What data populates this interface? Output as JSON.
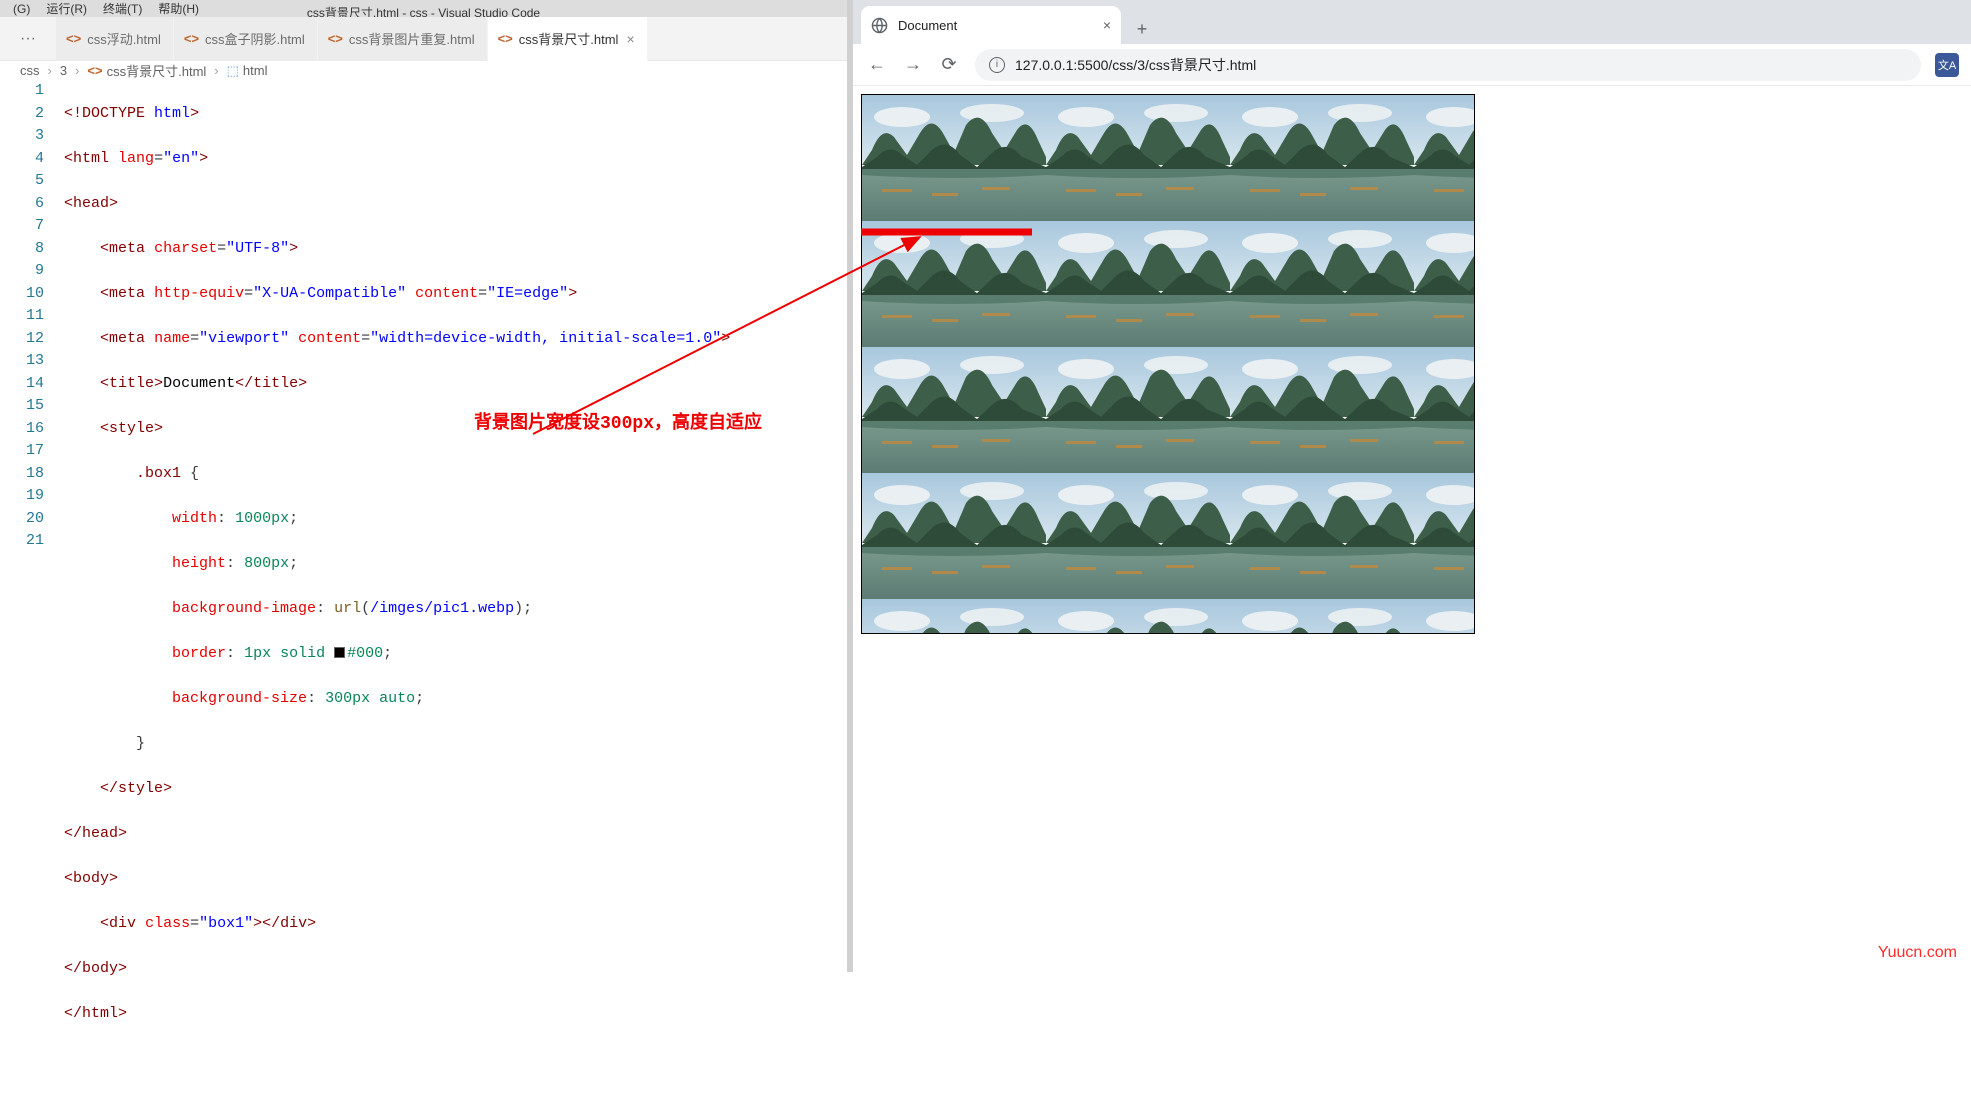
{
  "vscode": {
    "menubar": [
      "(G)",
      "运行(R)",
      "终端(T)",
      "帮助(H)"
    ],
    "title": "css背景尺寸.html - css - Visual Studio Code",
    "tabs": [
      {
        "label": "css浮动.html",
        "active": false
      },
      {
        "label": "css盒子阴影.html",
        "active": false
      },
      {
        "label": "css背景图片重复.html",
        "active": false
      },
      {
        "label": "css背景尺寸.html",
        "active": true
      }
    ],
    "breadcrumbs": {
      "parts": [
        "css",
        "3"
      ],
      "file": "css背景尺寸.html",
      "symbol": "html"
    },
    "line_count": 21,
    "code": {
      "l1_doctype": "!DOCTYPE",
      "l1_html": "html",
      "l2_tag": "html",
      "l2_attr": "lang",
      "l2_val": "\"en\"",
      "l3_tag": "head",
      "l4_tag": "meta",
      "l4_attr": "charset",
      "l4_val": "\"UTF-8\"",
      "l5_tag": "meta",
      "l5_a1": "http-equiv",
      "l5_v1": "\"X-UA-Compatible\"",
      "l5_a2": "content",
      "l5_v2": "\"IE=edge\"",
      "l6_tag": "meta",
      "l6_a1": "name",
      "l6_v1": "\"viewport\"",
      "l6_a2": "content",
      "l6_v2": "\"width=device-width, initial-scale=1.0\"",
      "l7_tag": "title",
      "l7_text": "Document",
      "l8_tag": "style",
      "l9_sel": ".box1",
      "l10_p": "width",
      "l10_v": "1000px",
      "l11_p": "height",
      "l11_v": "800px",
      "l12_p": "background-image",
      "l12_fn": "url",
      "l12_arg": "/imges/pic1.webp",
      "l13_p": "border",
      "l13_v1": "1px",
      "l13_v2": "solid",
      "l13_v3": "#000",
      "l14_p": "background-size",
      "l14_v1": "300px",
      "l14_v2": "auto",
      "l16_tag": "style",
      "l17_tag": "head",
      "l18_tag": "body",
      "l19_tag": "div",
      "l19_attr": "class",
      "l19_val": "\"box1\"",
      "l20_tag": "body",
      "l21_tag": "html"
    },
    "annotation": "背景图片宽度设300px，高度自适应"
  },
  "browser": {
    "tab_title": "Document",
    "url": "127.0.0.1:5500/css/3/css背景尺寸.html"
  },
  "watermark": "Yuucn.com"
}
